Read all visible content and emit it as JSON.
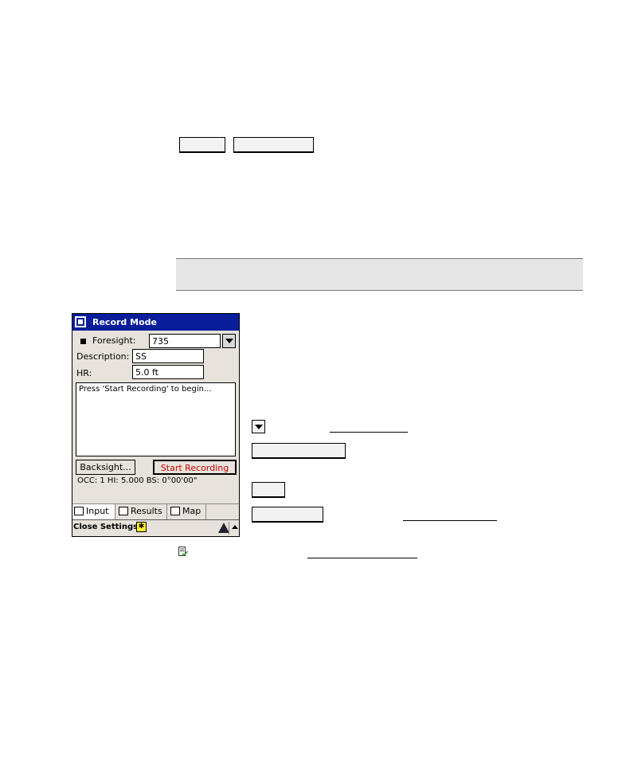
{
  "record_mode_window": {
    "title": "Record Mode",
    "foresight_label": "Foresight:",
    "foresight_value": "735",
    "description_label": "Description:",
    "description_value": "SS",
    "hr_label": "HR:",
    "hr_value": "5.0 ft",
    "message": "Press 'Start Recording' to begin...",
    "backsight_button": "Backsight...",
    "start_recording_button": "Start Recording",
    "status": "OCC: 1  HI: 5.000  BS: 0°00'00\"",
    "tabs": [
      {
        "label": "Input"
      },
      {
        "label": "Results"
      },
      {
        "label": "Map"
      }
    ],
    "close_settings": "Close Settings"
  },
  "colors": {
    "titlebar": "#0a1d9a",
    "start_recording_text": "#cc0000",
    "note_band": "#e6e6e6"
  },
  "icons": [
    "app-icon",
    "dropdown-arrow-icon",
    "input-tab-icon",
    "results-tab-icon",
    "map-tab-icon",
    "star-icon",
    "triangle-icon",
    "up-arrow-icon",
    "checklist-icon"
  ]
}
